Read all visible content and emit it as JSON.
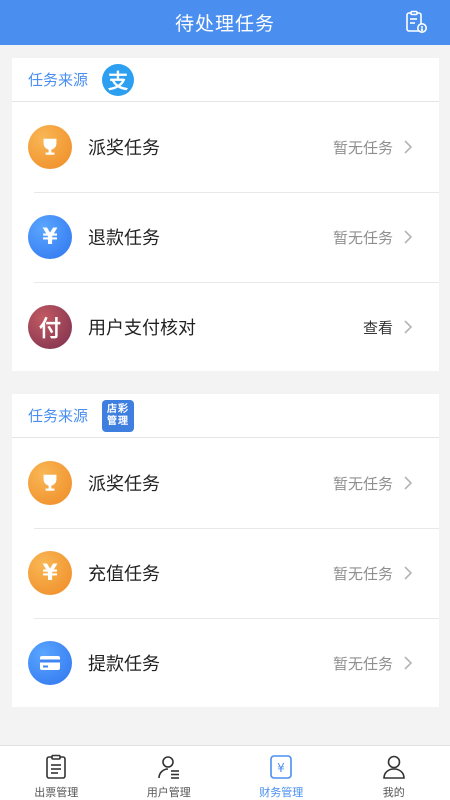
{
  "header": {
    "title": "待处理任务",
    "icon": "clipboard-info-icon"
  },
  "section1": {
    "source_label": "任务来源",
    "logo_char": "支",
    "items": [
      {
        "label": "派奖任务",
        "status": "暂无任务",
        "icon": "trophy-icon",
        "color": "#f29a33"
      },
      {
        "label": "退款任务",
        "status": "暂无任务",
        "icon": "yuan-icon",
        "color": "#3f86f2",
        "glyph": "¥"
      },
      {
        "label": "用户支付核对",
        "status": "查看",
        "icon": "pay-icon",
        "color": "#8e3b52",
        "glyph": "付"
      }
    ]
  },
  "section2": {
    "source_label": "任务来源",
    "logo_line1": "店彩",
    "logo_line2": "管理",
    "items": [
      {
        "label": "派奖任务",
        "status": "暂无任务",
        "icon": "trophy-icon",
        "color": "#f29a33"
      },
      {
        "label": "充值任务",
        "status": "暂无任务",
        "icon": "yuan-icon",
        "color": "#f29a33",
        "glyph": "¥"
      },
      {
        "label": "提款任务",
        "status": "暂无任务",
        "icon": "card-icon",
        "color": "#3f86f2"
      }
    ]
  },
  "tabbar": {
    "active": "财务管理",
    "tabs": [
      {
        "label": "出票管理",
        "icon": "ticket-list-icon"
      },
      {
        "label": "用户管理",
        "icon": "user-manage-icon"
      },
      {
        "label": "财务管理",
        "icon": "finance-icon"
      },
      {
        "label": "我的",
        "icon": "profile-icon"
      }
    ]
  }
}
